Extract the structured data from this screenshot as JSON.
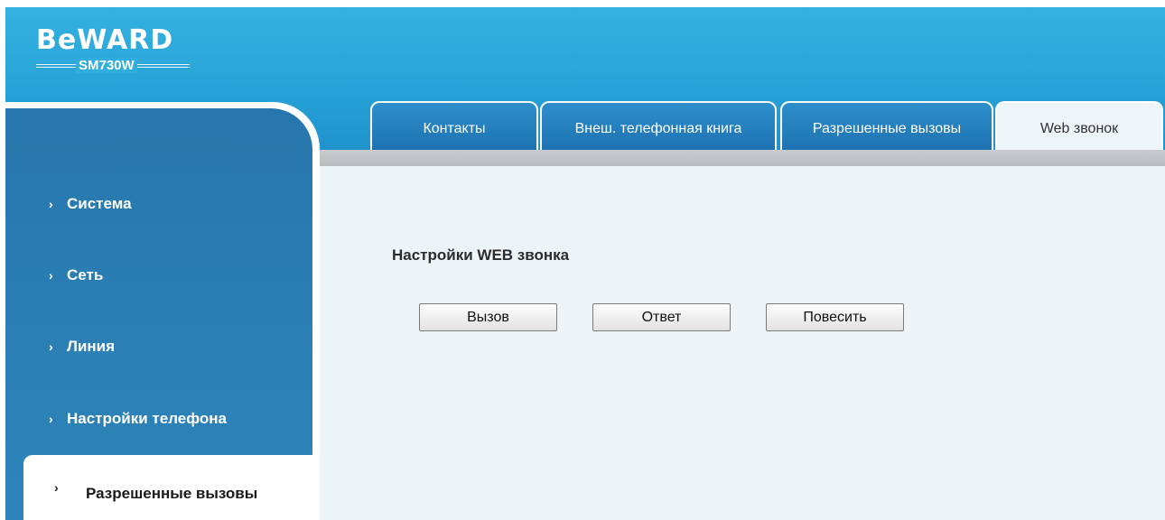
{
  "header": {
    "brand": "BeWARD",
    "model": "SM730W"
  },
  "tabs": [
    {
      "label": "Контакты",
      "active": false
    },
    {
      "label": "Внеш. телефонная книга",
      "active": false
    },
    {
      "label": "Разрешенные вызовы",
      "active": false
    },
    {
      "label": "Web звонок",
      "active": true
    }
  ],
  "sidebar": {
    "items": [
      {
        "label": "Система"
      },
      {
        "label": "Сеть"
      },
      {
        "label": "Линия"
      },
      {
        "label": "Настройки телефона"
      },
      {
        "label": "Разрешенные вызовы",
        "active": true
      }
    ],
    "chevron": "›"
  },
  "main": {
    "section_title": "Настройки WEB звонка",
    "buttons": {
      "call": "Вызов",
      "answer": "Ответ",
      "hangup": "Повесить"
    }
  },
  "colors": {
    "header": "#2aa6d9",
    "sidebar": "#2a7db3",
    "tab": "#1f72b2",
    "content_bg": "#edf4f7"
  }
}
